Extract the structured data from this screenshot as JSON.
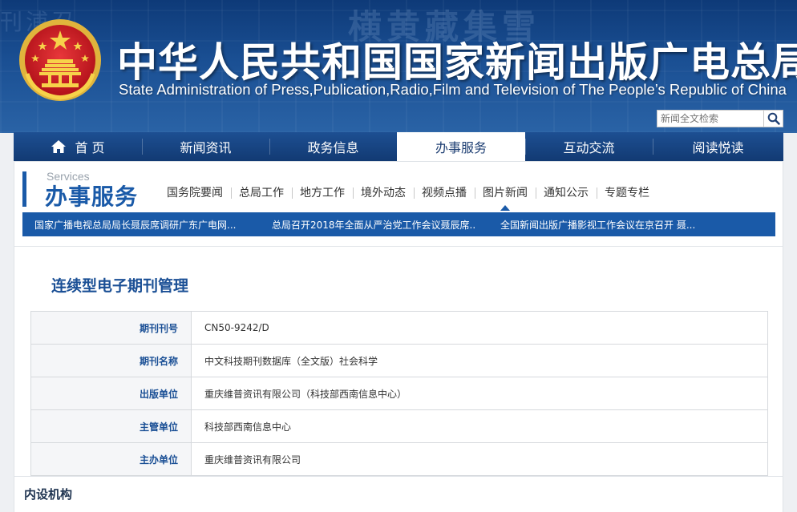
{
  "header": {
    "title_cn": "中华人民共和国国家新闻出版广电总局",
    "title_en": "State Administration of Press,Publication,Radio,Film and Television of The People’s Republic of China",
    "search_placeholder": "新闻全文检索"
  },
  "nav": [
    {
      "label": "首 页"
    },
    {
      "label": "新闻资讯"
    },
    {
      "label": "政务信息"
    },
    {
      "label": "办事服务"
    },
    {
      "label": "互动交流"
    },
    {
      "label": "阅读悦读"
    }
  ],
  "section": {
    "en": "Services",
    "cn": "办事服务"
  },
  "subnav": [
    {
      "label": "国务院要闻"
    },
    {
      "label": "总局工作"
    },
    {
      "label": "地方工作"
    },
    {
      "label": "境外动态"
    },
    {
      "label": "视频点播"
    },
    {
      "label": "图片新闻"
    },
    {
      "label": "通知公示"
    },
    {
      "label": "专题专栏"
    }
  ],
  "ticker": [
    {
      "text": "国家广播电视总局局长聂辰席调研广东广电网..."
    },
    {
      "text": "总局召开2018年全面从严治党工作会议聂辰席..."
    },
    {
      "text": "全国新闻出版广播影视工作会议在京召开 聂..."
    }
  ],
  "page": {
    "title": "连续型电子期刊管理",
    "rows": [
      {
        "key": "期刊刊号",
        "value": "CN50-9242/D"
      },
      {
        "key": "期刊名称",
        "value": "中文科技期刊数据库（全文版）社会科学"
      },
      {
        "key": "出版单位",
        "value": "重庆维普资讯有限公司（科技部西南信息中心）"
      },
      {
        "key": "主管单位",
        "value": "科技部西南信息中心"
      },
      {
        "key": "主办单位",
        "value": "重庆维普资讯有限公司"
      }
    ],
    "bottom_title": "内设机构"
  },
  "colors": {
    "primary_blue": "#1a5aa8",
    "nav_dark": "#123a73",
    "title_blue": "#1a4f95"
  }
}
